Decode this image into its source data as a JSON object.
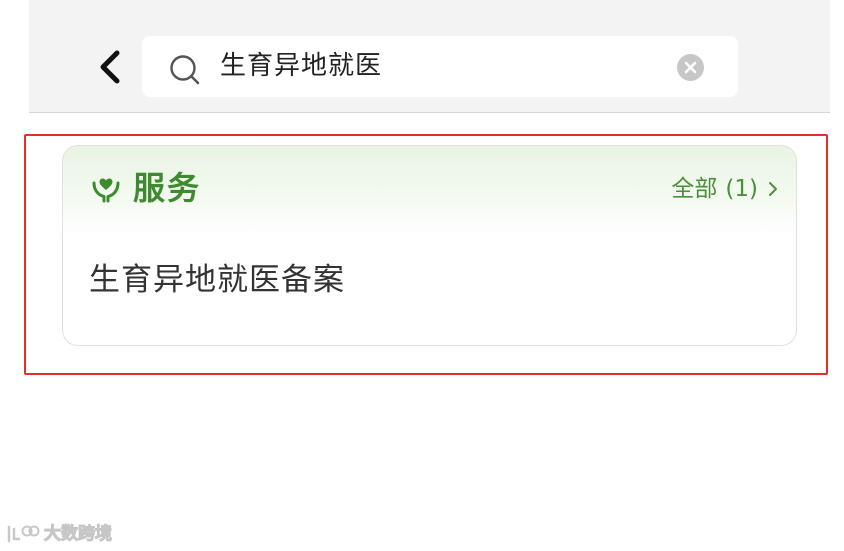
{
  "search": {
    "query": "生育异地就医",
    "back_icon": "chevron-left-icon",
    "search_icon": "search-icon",
    "clear_icon": "clear-icon"
  },
  "service_section": {
    "title": "服务",
    "icon": "service-heart-hands-icon",
    "view_all_label": "全部",
    "view_all_count": "(1)",
    "items": [
      {
        "label": "生育异地就医备案"
      }
    ]
  },
  "watermark": {
    "text": "大数跨境"
  },
  "colors": {
    "header_bg": "#f3f3f3",
    "accent_green": "#3e8a2f",
    "highlight_red": "#e0302a",
    "text_primary": "#333333"
  }
}
